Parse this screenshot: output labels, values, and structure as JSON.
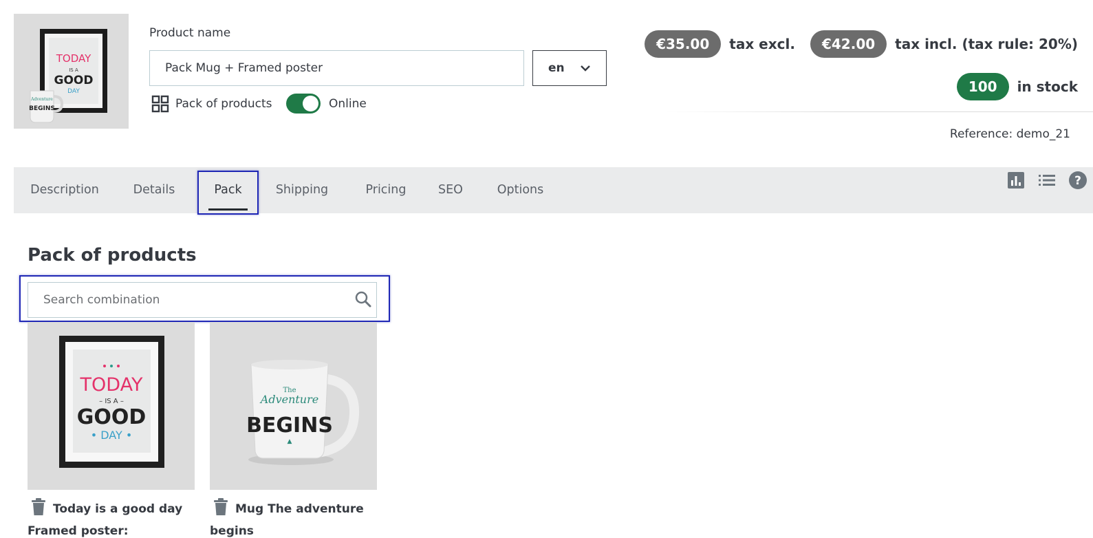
{
  "header": {
    "product_name_label": "Product name",
    "product_name_value": "Pack Mug + Framed poster",
    "language": "en",
    "product_type": "Pack of products",
    "online_label": "Online",
    "online": true,
    "price_tax_excl": "€35.00",
    "tax_excl_label": "tax excl.",
    "price_tax_incl": "€42.00",
    "tax_incl_label": "tax incl. (tax rule: 20%)",
    "stock_quantity": "100",
    "stock_label": "in stock",
    "reference": "Reference: demo_21"
  },
  "tabs": [
    {
      "label": "Description",
      "active": false
    },
    {
      "label": "Details",
      "active": false
    },
    {
      "label": "Pack",
      "active": true
    },
    {
      "label": "Shipping",
      "active": false
    },
    {
      "label": "Pricing",
      "active": false
    },
    {
      "label": "SEO",
      "active": false
    },
    {
      "label": "Options",
      "active": false
    }
  ],
  "toolbar_icons": [
    "bar-chart-icon",
    "list-icon",
    "help-icon"
  ],
  "pack": {
    "title": "Pack of products",
    "search_placeholder": "Search combination",
    "items": [
      {
        "name_line1": "Today is a good day",
        "name_line2": "Framed poster: Dimension"
      },
      {
        "name_line1": "Mug The adventure",
        "name_line2": "begins"
      }
    ]
  },
  "colors": {
    "accent_green": "#1f7a47",
    "price_pill": "#6c6c6c",
    "focus_outline": "#1f27b5",
    "tab_bar": "#eaebec"
  }
}
